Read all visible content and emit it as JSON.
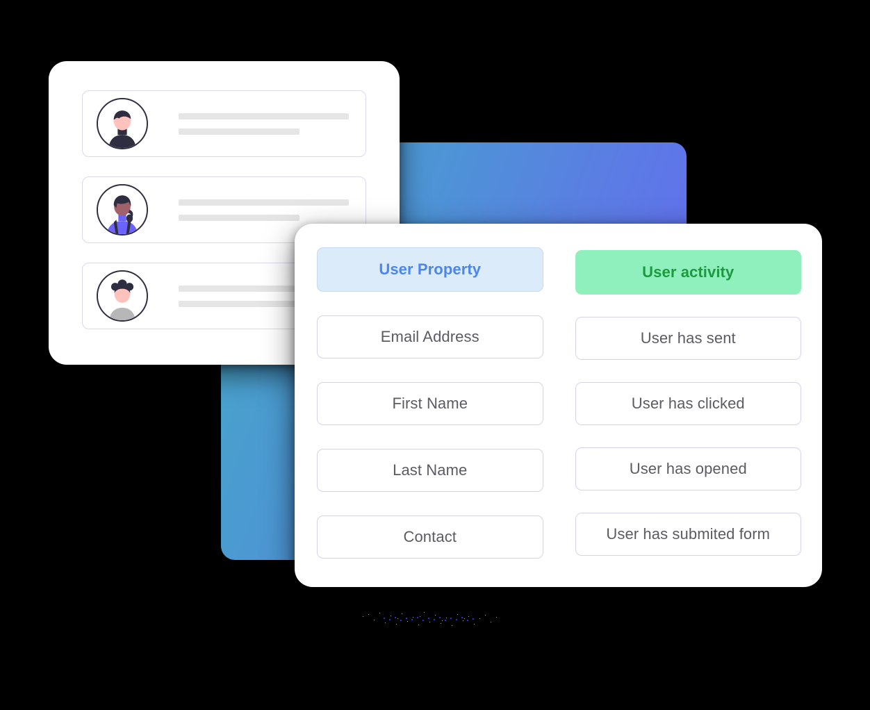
{
  "users_card": {
    "name": "user-list-card",
    "rows": [
      {
        "avatar": "avatar-person-dark-hair",
        "line_top": "",
        "line_bottom": ""
      },
      {
        "avatar": "avatar-person-ponytail",
        "line_top": "",
        "line_bottom": ""
      },
      {
        "avatar": "avatar-person-buns",
        "line_top": "",
        "line_bottom": ""
      }
    ]
  },
  "filters_card": {
    "left_column": {
      "header_label": "User Property",
      "items": [
        {
          "label": "Email Address"
        },
        {
          "label": "First Name"
        },
        {
          "label": "Last Name"
        },
        {
          "label": "Contact"
        }
      ]
    },
    "right_column": {
      "header_label": "User activity",
      "items": [
        {
          "label": "User has sent"
        },
        {
          "label": "User has clicked"
        },
        {
          "label": "User has opened"
        },
        {
          "label": "User has submited form"
        }
      ]
    }
  },
  "colors": {
    "background": "#000000",
    "card_surface": "#ffffff",
    "chip_border": "#D6D3E8",
    "chip_text": "#5B5B64",
    "active_blue_bg": "#DCEBFA",
    "active_blue_text": "#4A86EE",
    "active_green_bg": "#8FF0BE",
    "active_green_text": "#1B9B3E",
    "placeholder_bar": "#E6E5E5",
    "row_border": "#DCD9EC",
    "gradient_start": "#45A9C6",
    "gradient_end": "#6765F4",
    "avatar_outline": "#2F2E41"
  }
}
